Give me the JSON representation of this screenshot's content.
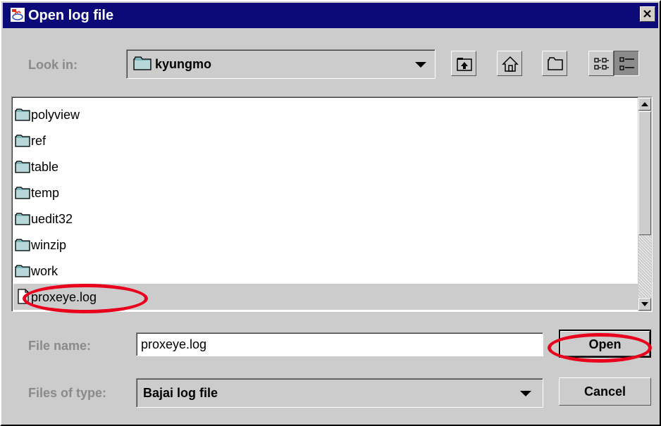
{
  "dialog": {
    "title": "Open log file",
    "close_glyph": "×"
  },
  "look_in": {
    "label": "Look in:",
    "value": "kyungmo"
  },
  "toolbar": {
    "icons": [
      "up-one-level-icon",
      "home-icon",
      "create-new-folder-icon",
      "list-view-icon",
      "details-view-icon"
    ]
  },
  "files": [
    {
      "name": "polyview",
      "type": "folder"
    },
    {
      "name": "ref",
      "type": "folder"
    },
    {
      "name": "table",
      "type": "folder"
    },
    {
      "name": "temp",
      "type": "folder"
    },
    {
      "name": "uedit32",
      "type": "folder"
    },
    {
      "name": "winzip",
      "type": "folder"
    },
    {
      "name": "work",
      "type": "folder"
    },
    {
      "name": "proxeye.log",
      "type": "file",
      "selected": true
    }
  ],
  "file_name": {
    "label": "File name:",
    "value": "proxeye.log"
  },
  "files_of_type": {
    "label": "Files of type:",
    "value": "Bajai log file"
  },
  "buttons": {
    "open": "Open",
    "cancel": "Cancel"
  },
  "colors": {
    "title_bar": "#0b0a78",
    "dialog_bg": "#cccccc",
    "highlight_annotation": "#e8001c"
  }
}
